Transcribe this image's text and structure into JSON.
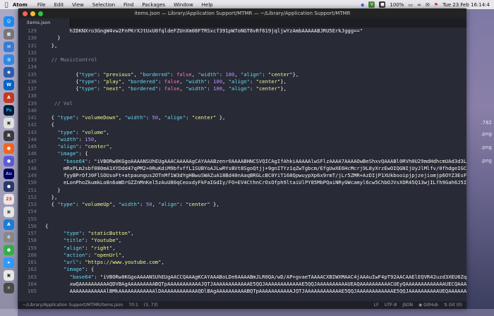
{
  "menubar": {
    "app": "Atom",
    "items": [
      "File",
      "Edit",
      "View",
      "Selection",
      "Find",
      "Packages",
      "Window",
      "Help"
    ],
    "battery": "100%",
    "datetime": "Tue 23 Feb  16:14:4"
  },
  "window": {
    "title": "items.json — Library/Application Support/MTMR — ~/Library/Application Support/MTMR",
    "tab": "items.json"
  },
  "wallpaper_labels": [
    ".782",
    ".png",
    ".png",
    ".png"
  ],
  "code_lines": [
    {
      "n": "129",
      "t": "        hIDKNXro3GngW4vw2FnPKrXJtUxU0fqldeFZUnXm08FTRSxcf391pW7oNGT8vRf619jqljwYzAmbAAAAABJRU5ErkJggg==\""
    },
    {
      "n": "130",
      "t": "    }"
    },
    {
      "n": "131",
      "t": "  },"
    },
    {
      "n": "132",
      "t": ""
    },
    {
      "n": "133",
      "t": "  // MusicControl"
    },
    {
      "n": "134",
      "t": ""
    },
    {
      "n": "135",
      "t": "          {\"type\": \"previous\", \"bordered\": false, \"width\": 100, \"align\": \"center\"},"
    },
    {
      "n": "136",
      "t": "          {\"type\": \"play\", \"bordered\": false, \"width\": 100, \"align\": \"center\"},"
    },
    {
      "n": "137",
      "t": "          {\"type\": \"next\", \"bordered\": false, \"width\": 100, \"align\": \"center\"},"
    },
    {
      "n": "138",
      "t": ""
    },
    {
      "n": "139",
      "t": "   // Vol"
    },
    {
      "n": "140",
      "t": ""
    },
    {
      "n": "141",
      "t": "  { \"type\": \"volumeDown\", \"width\": 50, \"align\": \"center\" },"
    },
    {
      "n": "142",
      "t": "  {"
    },
    {
      "n": "143",
      "t": "    \"type\": \"volume\","
    },
    {
      "n": "144",
      "t": "    \"width\": 150,"
    },
    {
      "n": "145",
      "t": "    \"align\": \"center\","
    },
    {
      "n": "146",
      "t": "    \"image\": {"
    },
    {
      "n": "147",
      "t": "      \"base64\": \"iVBORw0KGgoAAAANSUhEUgAAACAAAAAgCAYAAABzenr0AAAABHNCSVQICAgIfAhkiAAAAAlwSFlzAAAA7AAAAOwBeShxvQAAABl0RVh0U29mdHdhcmUAd3d3Lmlua3NjYXBlLm9"
    },
    {
      "n": "148",
      "t": "      mRxPLmJsbf080mA1XYDdd47qPM2+0RuKdiM9bfvffL1SUBYoAJLwRYsBVt8SgoQtjj+9gnITYz1qZwTgbcm/EfgUwXE6HcMcrj9L8yXrzEwOIQGNIjUyJlMlfv/0fhdgeIGC+rSQxRaujgzKSx"
    },
    {
      "n": "149",
      "t": "      fyyBPrOfJ0FlSOUsoFt+atpaungus2OTnMf1W3dYgHBwuSWAZuA18Bd40nAaqBRGLcBC0YiT168QpwuypXp6x9rmT/jLr5ZMR+AzDIjP1XUkbooipjpjzejiomjp6OYZ3EsFVArktU88KFr"
    },
    {
      "n": "150",
      "t": "      eLonPhoZkumkLo8n6aWDrGZZnMnKel5zAuU80qCeoxdyFkFaIGdIy/FO+EV4CthnCrOsOfph9ltaiUlPY85MbPQaiNRyGWcamyl6cw5ChbOJVsXOR45Q13wjILfh9Gah6J5IS6SqrMXae++xL"
    },
    {
      "n": "151",
      "t": "    }"
    },
    {
      "n": "152",
      "t": "  },"
    },
    {
      "n": "153",
      "t": "  { \"type\": \"volumeUp\", \"width\": 50, \"align\": \"center\" },"
    },
    {
      "n": "154",
      "t": ""
    },
    {
      "n": "155",
      "t": ""
    },
    {
      "n": "156",
      "t": "{"
    },
    {
      "n": "157",
      "t": "      \"type\": \"staticButton\","
    },
    {
      "n": "158",
      "t": "      \"title\": \"Youtube\","
    },
    {
      "n": "159",
      "t": "      \"align\": \"right\","
    },
    {
      "n": "160",
      "t": "      \"action\": \"openUrl\","
    },
    {
      "n": "161",
      "t": "      \"url\": \"https://www.youtube.com\","
    },
    {
      "n": "162",
      "t": "      \"image\": {"
    },
    {
      "n": "163",
      "t": "        \"base64\": \"iVBORw0KGgoAAAANSUhEUgAACCQAAAgKCAYAAABoLDe6AAAABmJLR0QA/wD/AP+gvaeTAAAACXBIWXMAAC4jAAAuIwF4pT92AACAAElEQVR42uzd3XEU6Zqu4efbMedVH1S"
    },
    {
      "n": "164",
      "t": "        xwQAAAAAAAAAAQDVBAgAAAAAAAAABQTpAAAAAAAAAAAJQTJAAAAAAAAAAAAE5QQJAAAAAAAAAAAAE5QQJAAAAAAAAAAUEAQAAAAAAAAAACUEyQAAAAAAAAAAAAAUECQAAAAAAAAAAIUECAAAAAAAAAA"
    },
    {
      "n": "165",
      "t": "        AAAAAAAAAAAAlBMkAAAAAAAAAAAAlDAAAAAAAAAAAAQDlBAgAAAAAAAAAABQTpAAAAAAAAAAAJQTJAAAAAAAAAAAAE5QQJAAAAAAAAAAAAE5QQJAAAAAAAAAAUEQAAAAAAAAAAACUEyQAAAAAAAAAAAAAUEC"
    }
  ],
  "statusbar": {
    "path": "~/Library/Application Support/MTMR/items.json",
    "pos": "70:1",
    "sel": "(3, 73)",
    "eol": "LF",
    "encoding": "UTF-8",
    "grammar": "JSON",
    "github": "GitHub",
    "git": "Git (0)"
  },
  "colors": {
    "accent": "#66d9ef",
    "string": "#f1fa8c",
    "number": "#bd93f9",
    "keyword": "#ff79c6"
  }
}
